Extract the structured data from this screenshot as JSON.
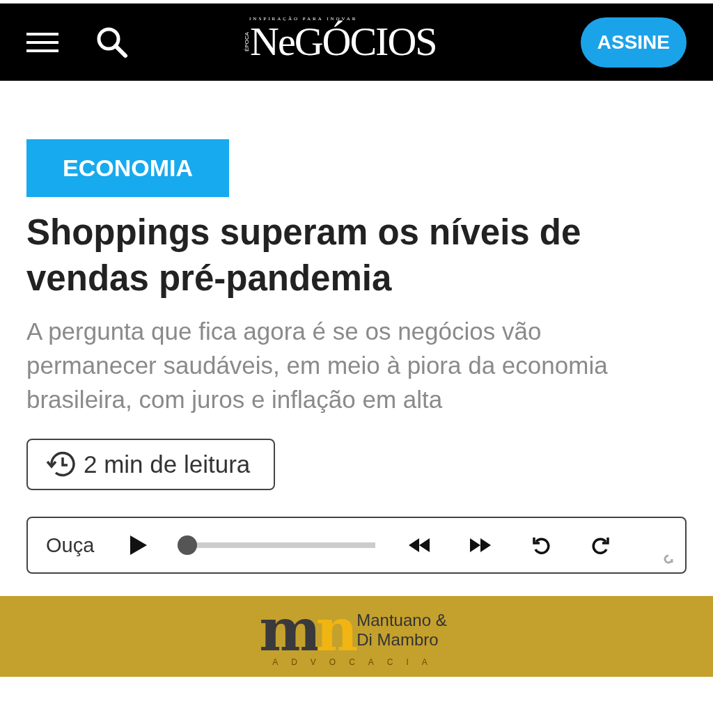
{
  "header": {
    "logo": {
      "tagline": "INSPIRAÇÃO PARA INOVAR",
      "brand": "ÉPOCA",
      "name": "NeGÓCIOS"
    },
    "subscribe": "ASSINE"
  },
  "article": {
    "category": "ECONOMIA",
    "title": "Shoppings superam os níveis de vendas pré-pandemia",
    "subtitle": "A pergunta que fica agora é se os negócios vão permanecer saudáveis, em meio à piora da economia brasileira, com juros e inflação em alta",
    "reading_time": "2 min de leitura"
  },
  "player": {
    "label": "Ouça",
    "level": 0
  },
  "ad": {
    "monogram_left": "m",
    "monogram_right": "n",
    "line1": "Mantuano &",
    "line2": "Di Mambro",
    "tagline": "ADVOCACIA"
  }
}
